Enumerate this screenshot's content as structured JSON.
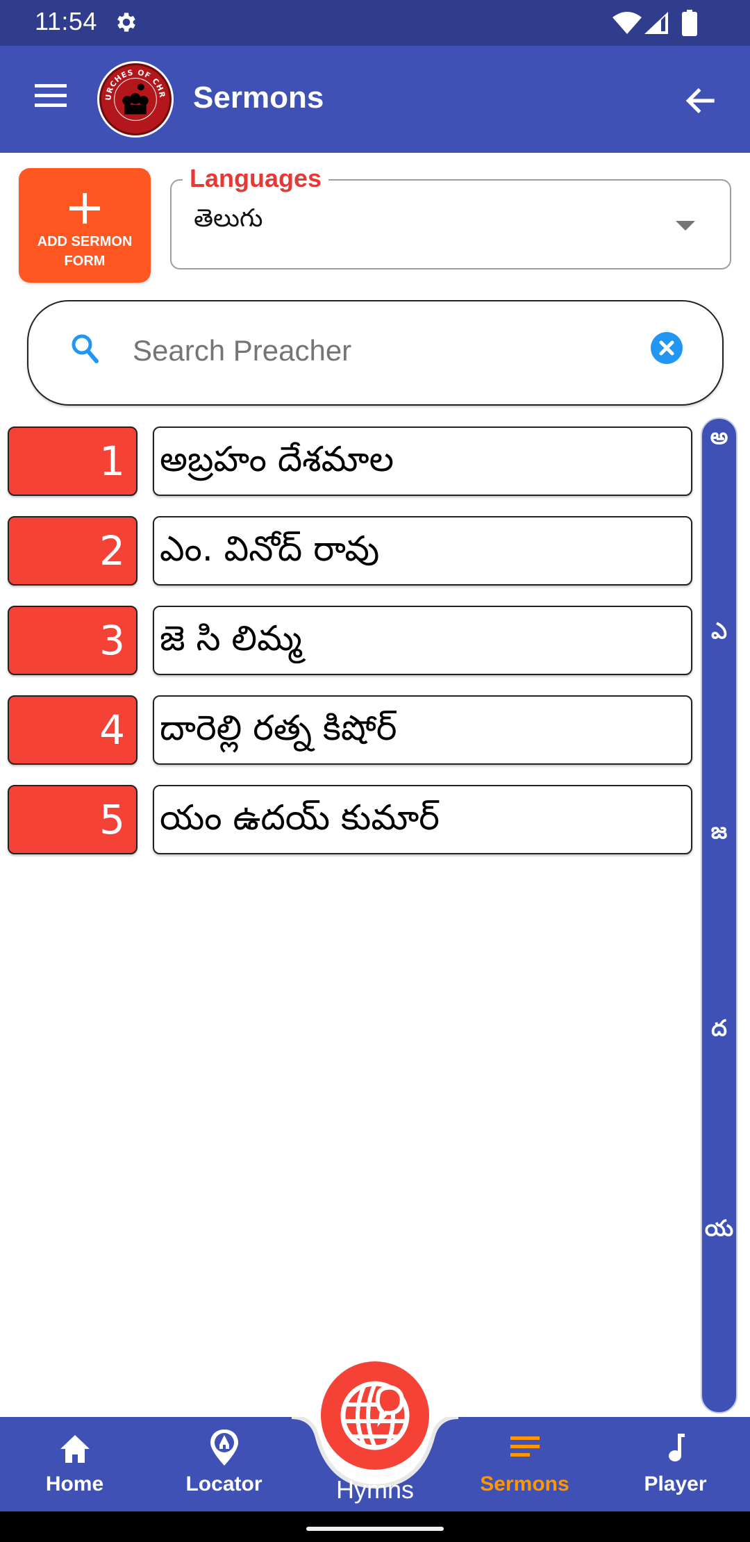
{
  "status_bar": {
    "time": "11:54",
    "icons": [
      "settings-gear-icon",
      "wifi-icon",
      "cellular-signal-icon",
      "battery-icon"
    ]
  },
  "app_bar": {
    "title": "Sermons",
    "logo_text": "CHURCHES OF CHRIST",
    "menu_icon": "hamburger-menu-icon",
    "back_icon": "arrow-left-icon"
  },
  "add_button": {
    "icon": "plus-icon",
    "label_line1": "ADD SERMON",
    "label_line2": "FORM"
  },
  "languages": {
    "label": "Languages",
    "selected": "తెలుగు"
  },
  "search": {
    "placeholder": "Search Preacher",
    "value": ""
  },
  "preachers": [
    {
      "number": "1",
      "name": "అబ్రహం దేశమాల"
    },
    {
      "number": "2",
      "name": "ఎం. వినోద్ రావు"
    },
    {
      "number": "3",
      "name": "జె సి లిమ్మ"
    },
    {
      "number": "4",
      "name": "దారెల్లి రత్న కిషోర్"
    },
    {
      "number": "5",
      "name": "యం ఉదయ్ కుమార్"
    }
  ],
  "index_bar": {
    "letters": [
      "అ",
      "ఎ",
      "జ",
      "ద",
      "య"
    ]
  },
  "bottom_nav": {
    "items": [
      {
        "label": "Home",
        "icon": "home-icon"
      },
      {
        "label": "Locator",
        "icon": "church-location-pin-icon"
      },
      {
        "label": "Hymns",
        "icon": "globe-speech-icon"
      },
      {
        "label": "Sermons",
        "icon": "sermons-lines-icon",
        "active": true
      },
      {
        "label": "Player",
        "icon": "music-note-icon"
      }
    ],
    "active_color": "#ff9800"
  },
  "colors": {
    "primary": "#3f51b5",
    "status_bar": "#2f3d8c",
    "accent_orange": "#ff5722",
    "number_red": "#f44336",
    "label_red": "#e53935",
    "clear_blue": "#2196f3"
  }
}
